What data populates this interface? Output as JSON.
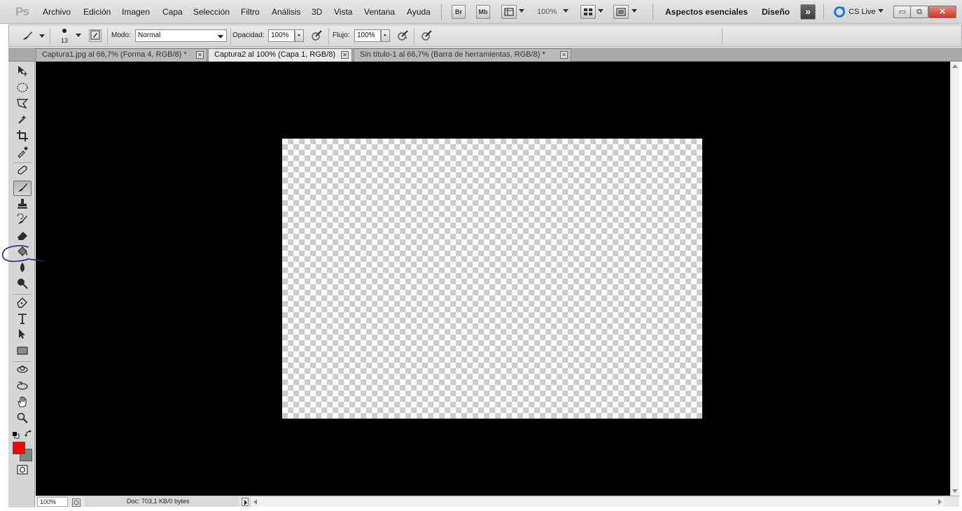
{
  "app": {
    "logo": "Ps",
    "menu": [
      "Archivo",
      "Edición",
      "Imagen",
      "Capa",
      "Selección",
      "Filtro",
      "Análisis",
      "3D",
      "Vista",
      "Ventana",
      "Ayuda"
    ],
    "bridge_label": "Br",
    "mini_bridge_label": "Mb",
    "zoom_value": "100%",
    "workspaces": [
      "Aspectos esenciales",
      "Diseño"
    ],
    "more_workspaces": "»",
    "cs_live": "CS Live",
    "window_controls": {
      "minimize": "▭",
      "restore": "⧉",
      "close": "✕"
    }
  },
  "options": {
    "brush_size": "13",
    "mode_label": "Modo:",
    "mode_value": "Normal",
    "opacity_label": "Opacidad:",
    "opacity_value": "100%",
    "flow_label": "Flujo:",
    "flow_value": "100%"
  },
  "tabs": [
    {
      "label": "Captura1.jpg al 66,7% (Forma 4, RGB/8) *",
      "active": false
    },
    {
      "label": "Captura2 al 100% (Capa 1, RGB/8)",
      "active": true
    },
    {
      "label": "Sin título-1 al 66,7% (Barra de  herramientas, RGB/8) *",
      "active": false
    }
  ],
  "tab_close_glyph": "✕",
  "tools": {
    "panel_toggle": "▸▸",
    "move": "move-tool-icon",
    "selected_tool": "brush",
    "foreground_color": "#ff0000",
    "background_color": "#808080"
  },
  "status": {
    "zoom": "100%",
    "doc_info": "Doc: 703,1 KB/0 bytes"
  },
  "colors": {
    "canvas_background": "#000000",
    "annotation": "#1a237e"
  }
}
